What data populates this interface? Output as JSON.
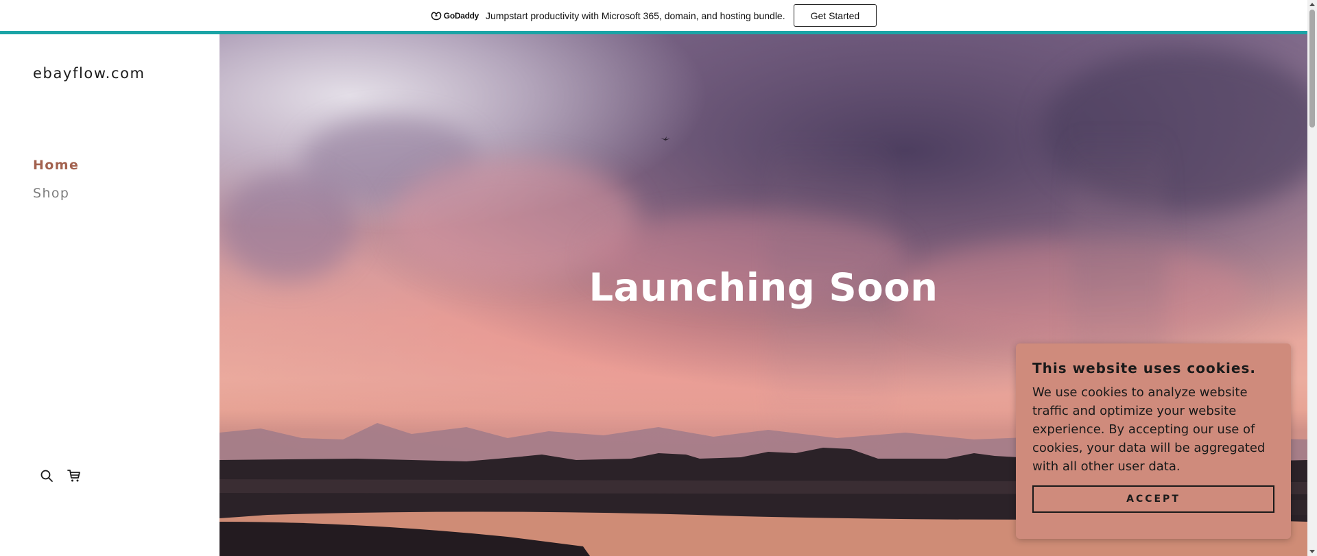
{
  "promo": {
    "logo_text": "GoDaddy",
    "message": "Jumpstart productivity with Microsoft 365, domain, and hosting bundle.",
    "cta_label": "Get Started",
    "accent_color": "#1ba4a6"
  },
  "sidebar": {
    "site_title": "ebayflow.com",
    "nav": [
      {
        "label": "Home",
        "active": true
      },
      {
        "label": "Shop",
        "active": false
      }
    ],
    "icons": [
      "search-icon",
      "cart-icon"
    ],
    "active_color": "#a3624f"
  },
  "hero": {
    "title": "Launching Soon"
  },
  "cookie": {
    "title": "This website uses cookies.",
    "text": "We use cookies to analyze website traffic and optimize your website experience. By accepting our use of cookies, your data will be aggregated with all other user data.",
    "accept_label": "ACCEPT",
    "background_color": "#cf8b7c"
  }
}
